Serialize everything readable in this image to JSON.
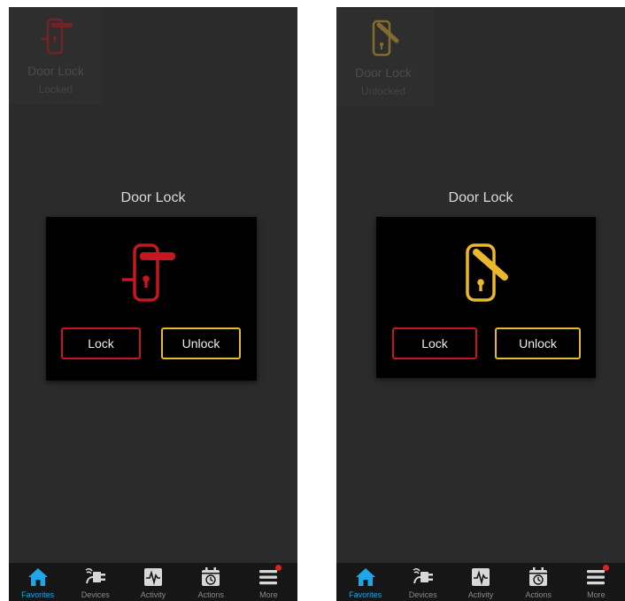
{
  "colors": {
    "locked_red": "#c6171d",
    "unlocked_yellow": "#e9b82d",
    "accent_blue": "#1ea6e6"
  },
  "screens": [
    {
      "tile": {
        "title": "Door Lock",
        "status": "Locked",
        "icon": "door-lock-locked-icon"
      },
      "dialog": {
        "title": "Door Lock",
        "icon": "door-lock-locked-icon",
        "lock_label": "Lock",
        "unlock_label": "Unlock"
      }
    },
    {
      "tile": {
        "title": "Door Lock",
        "status": "Unlocked",
        "icon": "door-lock-unlocked-icon"
      },
      "dialog": {
        "title": "Door Lock",
        "icon": "door-lock-unlocked-icon",
        "lock_label": "Lock",
        "unlock_label": "Unlock"
      }
    }
  ],
  "tabs": [
    {
      "label": "Favorites",
      "icon": "home-icon",
      "active": true
    },
    {
      "label": "Devices",
      "icon": "plug-icon",
      "active": false
    },
    {
      "label": "Activity",
      "icon": "activity-icon",
      "active": false
    },
    {
      "label": "Actions",
      "icon": "calendar-clock-icon",
      "active": false
    },
    {
      "label": "More",
      "icon": "menu-icon",
      "active": false,
      "badge": true
    }
  ]
}
